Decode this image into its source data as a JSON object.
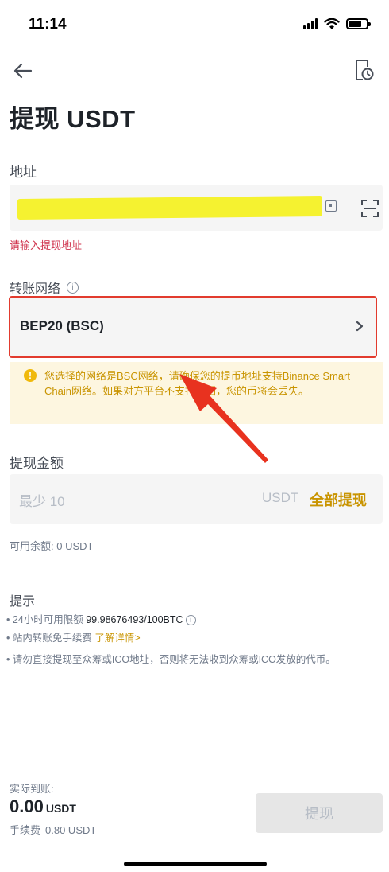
{
  "status": {
    "time": "11:14"
  },
  "page": {
    "title": "提现 USDT"
  },
  "address": {
    "label": "地址",
    "error": "请输入提现地址"
  },
  "network": {
    "label": "转账网络",
    "info_glyph": "i",
    "selected": "BEP20 (BSC)",
    "warning": "您选择的网络是BSC网络，请确保您的提币地址支持Binance Smart Chain网络。如果对方平台不支持找回，您的币将会丢失。",
    "warning_glyph": "!"
  },
  "amount": {
    "label": "提现金额",
    "placeholder": "最少 10",
    "unit": "USDT",
    "withdraw_all": "全部提现",
    "available": "可用余额: 0 USDT"
  },
  "tips": {
    "title": "提示",
    "limit_prefix": "• 24小时可用限额 ",
    "limit_value": "99.98676493/100BTC",
    "internal_prefix": "• 站内转账免手续费 ",
    "internal_link": "了解详情>",
    "ico_warning": "• 请勿直接提现至众筹或ICO地址，否则将无法收到众筹或ICO发放的代币。"
  },
  "footer": {
    "arrival_label": "实际到账:",
    "arrival_amount": "0.00",
    "arrival_unit": "USDT",
    "fee_label": "手续费",
    "fee_value": "0.80 USDT",
    "submit": "提现"
  },
  "icons": {
    "back": "arrow-left-icon",
    "history": "history-icon",
    "paste": "paste-icon",
    "scan": "scan-icon",
    "chevron": "chevron-right-icon",
    "warning": "warning-icon"
  },
  "colors": {
    "accent": "#c99400",
    "error": "#cf304a",
    "highlight_border": "#e23b2e",
    "warning_bg": "#fdf6e0",
    "annotation_arrow": "#e8321f"
  }
}
